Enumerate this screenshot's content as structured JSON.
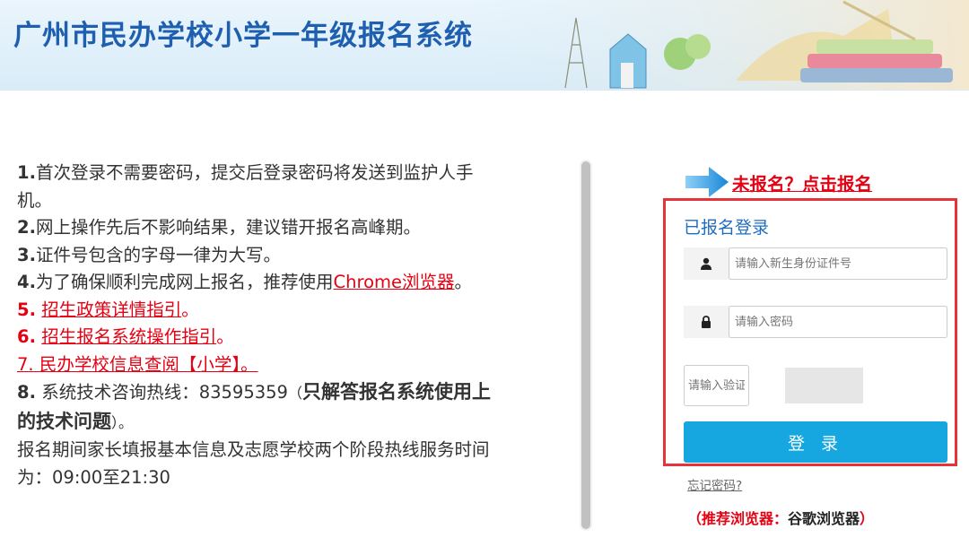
{
  "header": {
    "title": "广州市民办学校小学一年级报名系统"
  },
  "notes": {
    "n1_num": "1.",
    "n1_text": "首次登录不需要密码，提交后登录密码将发送到监护人手机。",
    "n2_num": "2.",
    "n2_text": "网上操作先后不影响结果，建议错开报名高峰期。",
    "n3_num": "3.",
    "n3_text": "证件号包含的字母一律为大写。",
    "n4_num": "4.",
    "n4_text": "为了确保顺利完成网上报名，推荐使用",
    "n4_link": "Chrome浏览器",
    "n4_end": "。",
    "n5_num": "5.",
    "n5_link": "招生政策详情指引",
    "n5_end": "。",
    "n6_num": "6.",
    "n6_link": "招生报名系统操作指引",
    "n6_end": "。",
    "n7_num": "7.",
    "n7_link": "民办学校信息查阅【小学】。",
    "n8_num": "8.",
    "n8_text": "系统技术咨询热线：83595359",
    "n8_paren": "（",
    "n8_bold": "只解答报名系统使用上的技术问题",
    "n8_end": "）。",
    "n9_text": "报名期间家长填报基本信息及志愿学校两个阶段热线服务时间为：09:00至21:30"
  },
  "register_link": "未报名？点击报名",
  "login": {
    "title": "已报名登录",
    "id_placeholder": "请输入新生身份证件号",
    "password_placeholder": "请输入密码",
    "captcha_placeholder": "请输入验证码",
    "button": "登 录"
  },
  "forgot_password": "忘记密码?",
  "browser_tip": {
    "prefix": "（推荐浏览器：",
    "name": "谷歌浏览器",
    "suffix": "）"
  },
  "colors": {
    "accent_blue": "#16a7e0",
    "title_blue": "#1f5fb0",
    "alert_red": "#e60012",
    "box_border": "#e6333a"
  },
  "icons": {
    "user": "user-icon",
    "lock": "lock-icon",
    "arrow": "arrow-right-icon"
  }
}
